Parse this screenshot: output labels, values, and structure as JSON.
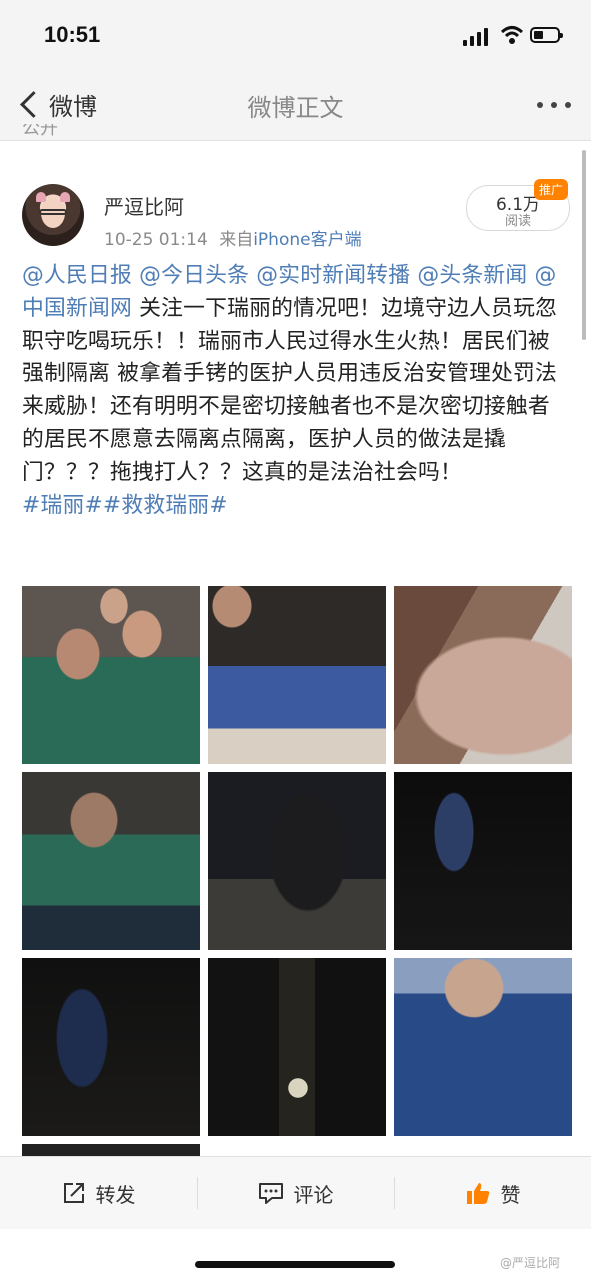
{
  "status_bar": {
    "time": "10:51"
  },
  "nav": {
    "back_label": "微博",
    "title": "微博正文"
  },
  "partial_row_text": "公开",
  "post": {
    "username": "严逗比阿",
    "timestamp": "10-25 01:14",
    "source_prefix": "来自",
    "source": "iPhone客户端",
    "promo_tag": "推广",
    "read_count": "6.1万",
    "read_label": "阅读",
    "mentions": [
      "@人民日报",
      "@今日头条",
      "@实时新闻转播",
      "@头条新闻",
      "@中国新闻网"
    ],
    "body": " 关注一下瑞丽的情况吧！边境守边人员玩忽职守吃喝玩乐！！瑞丽市人民过得水生火热！居民们被强制隔离 被拿着手铐的医护人员用违反治安管理处罚法来威胁！还有明明不是密切接触者也不是次密切接触者的居民不愿意去隔离点隔离，医护人员的做法是撬门？？？拖拽打人？？这真的是法治社会吗！",
    "hashtags": [
      "#瑞丽#",
      "#救救瑞丽#"
    ]
  },
  "actions": {
    "repost": "转发",
    "comment": "评论",
    "like": "赞"
  },
  "watermark": "@严逗比阿",
  "colors": {
    "link": "#4f7db5",
    "promo": "#ff8200",
    "like": "#ff8200"
  }
}
